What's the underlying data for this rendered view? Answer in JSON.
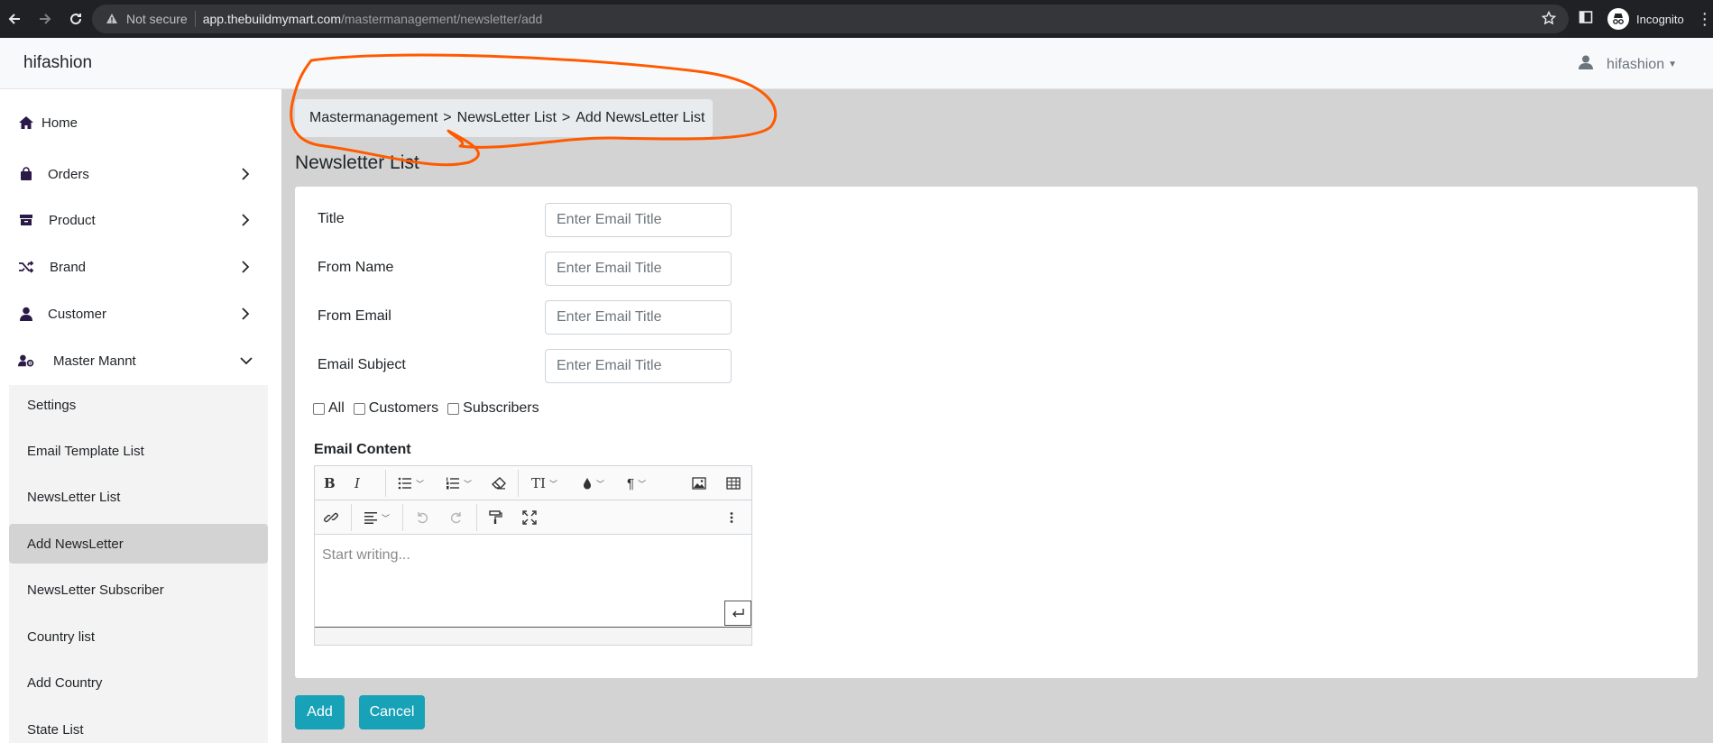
{
  "browser": {
    "security_label": "Not secure",
    "url_host": "app.thebuildmymart.com",
    "url_path": "/mastermanagement/newsletter/add",
    "profile_label": "Incognito"
  },
  "app": {
    "brand": "hifashion",
    "user_name": "hifashion"
  },
  "sidebar": {
    "items": [
      {
        "label": "Home",
        "icon": "home-icon"
      },
      {
        "label": "Orders",
        "icon": "shopping-bag-icon"
      },
      {
        "label": "Product",
        "icon": "archive-box-icon"
      },
      {
        "label": "Brand",
        "icon": "shuffle-icon"
      },
      {
        "label": "Customer",
        "icon": "user-icon"
      },
      {
        "label": "Master Mannt",
        "icon": "user-gear-icon"
      }
    ],
    "submenu": [
      {
        "label": "Settings"
      },
      {
        "label": "Email Template List"
      },
      {
        "label": "NewsLetter List"
      },
      {
        "label": "Add NewsLetter"
      },
      {
        "label": "NewsLetter Subscriber"
      },
      {
        "label": "Country list"
      },
      {
        "label": "Add Country"
      },
      {
        "label": "State List"
      }
    ]
  },
  "breadcrumb": {
    "items": [
      "Mastermanagement",
      "NewsLetter List",
      "Add NewsLetter List"
    ],
    "separator": ">"
  },
  "page_title": "Newsletter List",
  "form": {
    "fields": [
      {
        "label": "Title",
        "placeholder": "Enter Email Title"
      },
      {
        "label": "From Name",
        "placeholder": "Enter Email Title"
      },
      {
        "label": "From Email",
        "placeholder": "Enter Email Title"
      },
      {
        "label": "Email Subject",
        "placeholder": "Enter Email Title"
      }
    ],
    "recipients": [
      {
        "label": "All",
        "checked": false
      },
      {
        "label": "Customers",
        "checked": false
      },
      {
        "label": "Subscribers",
        "checked": false
      }
    ],
    "content_label": "Email Content",
    "editor_placeholder": "Start writing...",
    "toolbar": {
      "bold": "B",
      "italic": "I",
      "text_size": "TI",
      "paragraph": "¶"
    },
    "add_label": "Add",
    "cancel_label": "Cancel"
  },
  "colors": {
    "primary_button": "#17a2b8",
    "content_bg": "#d3d3d3",
    "annotation": "#ff5a00"
  }
}
